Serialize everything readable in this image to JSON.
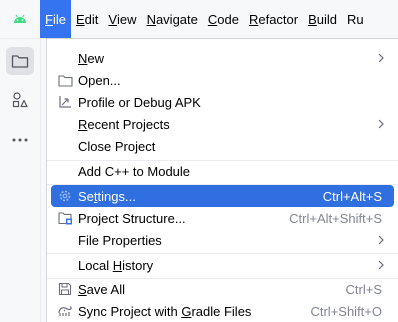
{
  "menubar": {
    "items": [
      {
        "label": "File",
        "mnemonic": "F",
        "rest": "ile",
        "active": true
      },
      {
        "label": "Edit",
        "mnemonic": "E",
        "rest": "dit"
      },
      {
        "label": "View",
        "mnemonic": "V",
        "rest": "iew"
      },
      {
        "label": "Navigate",
        "mnemonic": "N",
        "rest": "avigate"
      },
      {
        "label": "Code",
        "mnemonic": "C",
        "rest": "ode"
      },
      {
        "label": "Refactor",
        "mnemonic": "R",
        "rest": "efactor"
      },
      {
        "label": "Build",
        "mnemonic": "B",
        "rest": "uild"
      },
      {
        "label": "Ru",
        "mnemonic": "",
        "rest": "Ru"
      }
    ],
    "app_icon": "android-icon"
  },
  "toolstrip": {
    "icons": [
      "folder-icon",
      "shapes-icon",
      "more-icon"
    ]
  },
  "file_menu": {
    "new": {
      "pre": "",
      "mn": "N",
      "post": "ew"
    },
    "open": {
      "label": "Open..."
    },
    "profile": {
      "label": "Profile or Debug APK"
    },
    "recent": {
      "pre": "",
      "mn": "R",
      "post": "ecent Projects"
    },
    "close": {
      "label": "Close Project"
    },
    "add_cpp": {
      "label": "Add C++ to Module"
    },
    "settings": {
      "pre": "Se",
      "mn": "t",
      "post": "tings...",
      "shortcut": "Ctrl+Alt+S"
    },
    "structure": {
      "label": "Project Structure...",
      "shortcut": "Ctrl+Alt+Shift+S"
    },
    "file_props": {
      "label": "File Properties"
    },
    "local_history": {
      "pre": "Local ",
      "mn": "H",
      "post": "istory"
    },
    "save_all": {
      "pre": "",
      "mn": "S",
      "post": "ave All",
      "shortcut": "Ctrl+S"
    },
    "sync": {
      "pre": "Sync Project with ",
      "mn": "G",
      "post": "radle Files",
      "shortcut": "Ctrl+Shift+O"
    }
  },
  "colors": {
    "accent": "#3574f0",
    "selection": "#2f6fdf",
    "shortcut": "#818594"
  }
}
